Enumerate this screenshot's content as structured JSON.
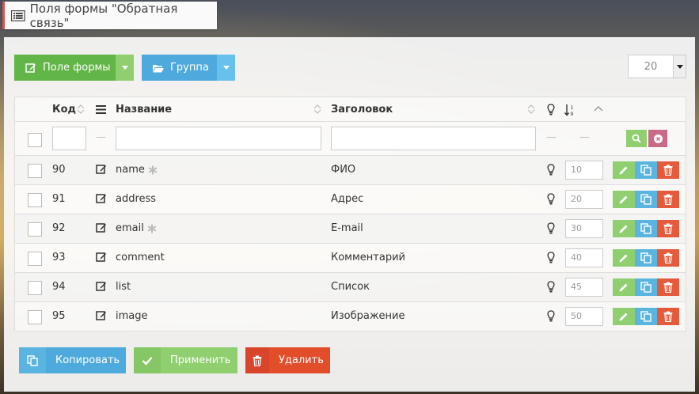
{
  "window": {
    "title": "Поля формы \"Обратная связь\""
  },
  "toolbar": {
    "add_field_label": "Поле формы",
    "group_label": "Группа",
    "per_page_value": "20"
  },
  "table": {
    "headers": {
      "code": "Код",
      "name": "Название",
      "caption": "Заголовок"
    },
    "filter": {
      "dash": "—"
    },
    "rows": [
      {
        "code": "90",
        "name": "name",
        "required": true,
        "caption": "ФИО",
        "sort": "10"
      },
      {
        "code": "91",
        "name": "address",
        "required": false,
        "caption": "Адрес",
        "sort": "20"
      },
      {
        "code": "92",
        "name": "email",
        "required": true,
        "caption": "E-mail",
        "sort": "30"
      },
      {
        "code": "93",
        "name": "comment",
        "required": false,
        "caption": "Комментарий",
        "sort": "40"
      },
      {
        "code": "94",
        "name": "list",
        "required": false,
        "caption": "Список",
        "sort": "45"
      },
      {
        "code": "95",
        "name": "image",
        "required": false,
        "caption": "Изображение",
        "sort": "50"
      }
    ]
  },
  "footer": {
    "copy_label": "Копировать",
    "apply_label": "Применить",
    "delete_label": "Удалить"
  },
  "colors": {
    "green": "#62b547",
    "green_light": "#8fcf6f",
    "blue": "#4ea9dc",
    "red": "#e45a3a",
    "accent_red": "#d9534f"
  },
  "icons": {
    "title": "list-icon",
    "add": "edit-icon",
    "group": "folder-open-icon",
    "search": "search-icon",
    "clear": "close-icon",
    "edit": "pencil-icon",
    "copy": "copy-icon",
    "delete": "trash-icon",
    "active": "lightbulb-icon",
    "required": "asterisk-icon"
  }
}
